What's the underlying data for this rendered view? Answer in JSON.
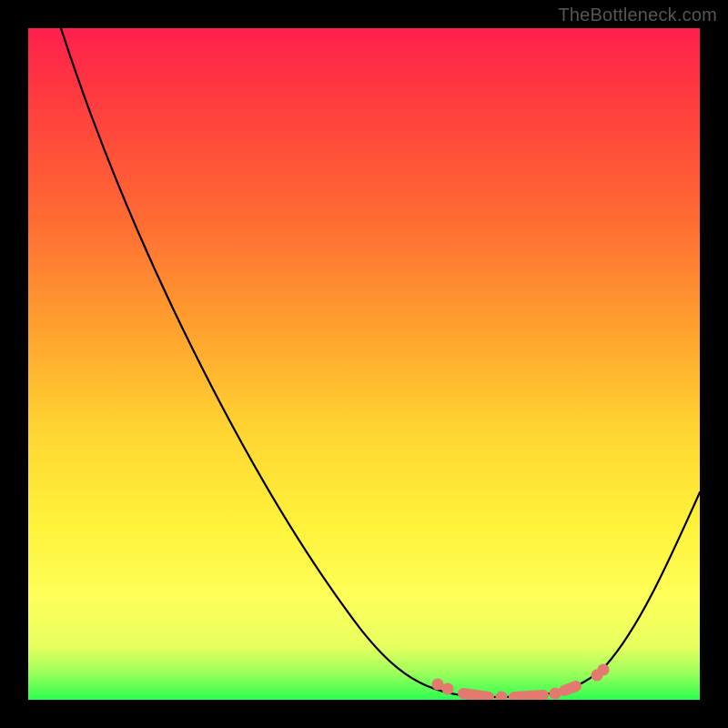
{
  "watermark": "TheBottleneck.com",
  "colors": {
    "frame": "#000000",
    "curve": "#000000",
    "marker": "#e27a6f",
    "gradient_stops": [
      {
        "pos": 0.0,
        "hex": "#ff1f4e"
      },
      {
        "pos": 0.1,
        "hex": "#ff3a3f"
      },
      {
        "pos": 0.28,
        "hex": "#ff6a33"
      },
      {
        "pos": 0.45,
        "hex": "#ffa22e"
      },
      {
        "pos": 0.6,
        "hex": "#ffd531"
      },
      {
        "pos": 0.74,
        "hex": "#fff23a"
      },
      {
        "pos": 0.85,
        "hex": "#feff5a"
      },
      {
        "pos": 0.92,
        "hex": "#e7ff5f"
      },
      {
        "pos": 0.96,
        "hex": "#9cff5b"
      },
      {
        "pos": 1.0,
        "hex": "#2bff50"
      }
    ]
  },
  "chart_data": {
    "type": "line",
    "title": "",
    "xlabel": "",
    "ylabel": "",
    "xlim": [
      0,
      100
    ],
    "ylim": [
      0,
      100
    ],
    "note": "Axes are not labeled in the source image; x is an implicit 0–100 horizontal position, y is an implicit 0–100 vertical (0 = bottom/green, 100 = top/red). Values below are estimated from the rendered curve.",
    "series": [
      {
        "name": "bottleneck-curve",
        "x": [
          5,
          12,
          20,
          30,
          40,
          50,
          58,
          64,
          70,
          76,
          82,
          88,
          94,
          100
        ],
        "y": [
          100,
          88,
          74,
          57,
          40,
          24,
          12,
          6,
          2,
          0,
          1,
          6,
          16,
          31
        ]
      }
    ],
    "markers": {
      "name": "highlighted-near-minimum",
      "x": [
        61,
        62,
        66,
        70,
        74,
        78,
        80,
        85,
        86
      ],
      "y": [
        3,
        2,
        1,
        0,
        0,
        1,
        2,
        4,
        5
      ]
    },
    "minimum": {
      "x": 73,
      "y": 0
    }
  }
}
